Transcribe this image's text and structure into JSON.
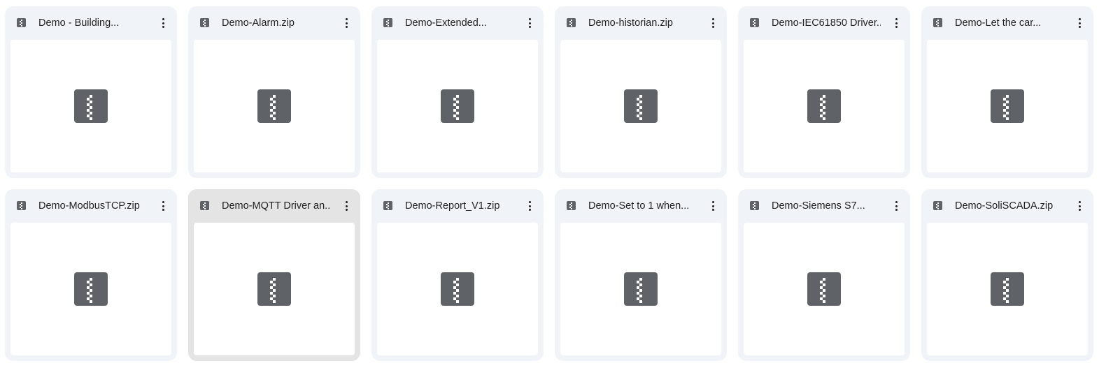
{
  "files": [
    {
      "name": "Demo - Building...",
      "icon": "zip-file-icon",
      "selected": false
    },
    {
      "name": "Demo-Alarm.zip",
      "icon": "zip-file-icon",
      "selected": false
    },
    {
      "name": "Demo-Extended...",
      "icon": "zip-file-icon",
      "selected": false
    },
    {
      "name": "Demo-historian.zip",
      "icon": "zip-file-icon",
      "selected": false
    },
    {
      "name": "Demo-IEC61850 Driver...",
      "icon": "zip-file-icon",
      "selected": false
    },
    {
      "name": "Demo-Let the car...",
      "icon": "zip-file-icon",
      "selected": false
    },
    {
      "name": "Demo-ModbusTCP.zip",
      "icon": "zip-file-icon",
      "selected": false
    },
    {
      "name": "Demo-MQTT Driver an...",
      "icon": "zip-file-icon",
      "selected": true
    },
    {
      "name": "Demo-Report_V1.zip",
      "icon": "zip-file-icon",
      "selected": false
    },
    {
      "name": "Demo-Set to 1 when...",
      "icon": "zip-file-icon",
      "selected": false
    },
    {
      "name": "Demo-Siemens S7...",
      "icon": "zip-file-icon",
      "selected": false
    },
    {
      "name": "Demo-SoliSCADA.zip",
      "icon": "zip-file-icon",
      "selected": false
    }
  ],
  "colors": {
    "card_bg": "#f0f4f9",
    "card_selected_bg": "#e4e4e4",
    "icon_gray": "#5f6368",
    "text": "#1f1f1f"
  }
}
